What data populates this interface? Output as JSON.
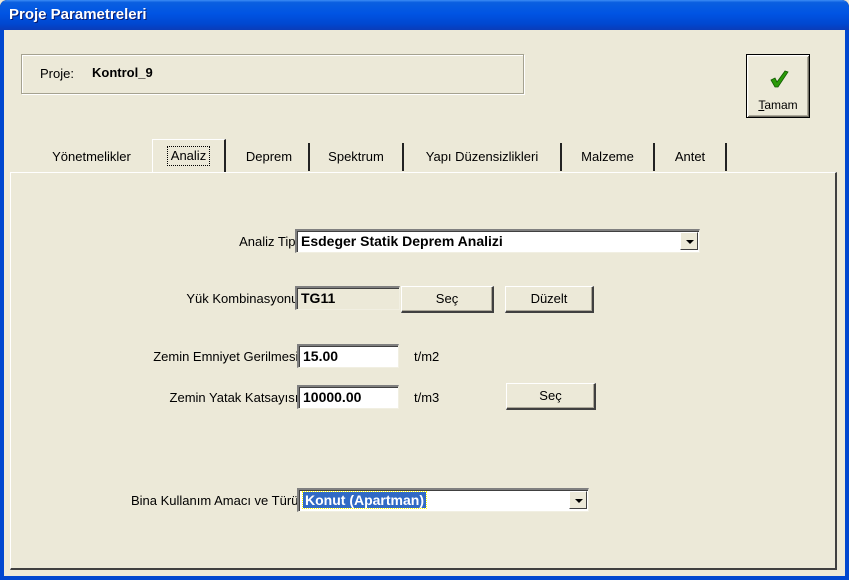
{
  "window": {
    "title": "Proje Parametreleri"
  },
  "project": {
    "label": "Proje:",
    "name": "Kontrol_9"
  },
  "ok_button": {
    "label": "Tamam",
    "icon": "checkmark-icon",
    "color": "#2a9a08"
  },
  "tabs": [
    {
      "label": "Yönetmelikler"
    },
    {
      "label": "Analiz"
    },
    {
      "label": "Deprem"
    },
    {
      "label": "Spektrum"
    },
    {
      "label": "Yapı Düzensizlikleri"
    },
    {
      "label": "Malzeme"
    },
    {
      "label": "Antet"
    }
  ],
  "active_tab": "Analiz",
  "analysis": {
    "type_label": "Analiz Tipi:",
    "type_value": "Esdeger Statik Deprem Analizi",
    "combo_label": "Yük Kombinasyonu:",
    "combo_value": "TG11",
    "combo_select_button": "Seç",
    "combo_edit_button": "Düzelt",
    "soil_stress_label": "Zemin Emniyet Gerilmesi:",
    "soil_stress_value": "15.00",
    "soil_stress_unit": "t/m2",
    "soil_coef_label": "Zemin Yatak Katsayısı:",
    "soil_coef_value": "10000.00",
    "soil_coef_unit": "t/m3",
    "soil_coef_select_button": "Seç",
    "building_use_label": "Bina Kullanım Amacı ve Türü:",
    "building_use_value": "Konut (Apartman)"
  }
}
